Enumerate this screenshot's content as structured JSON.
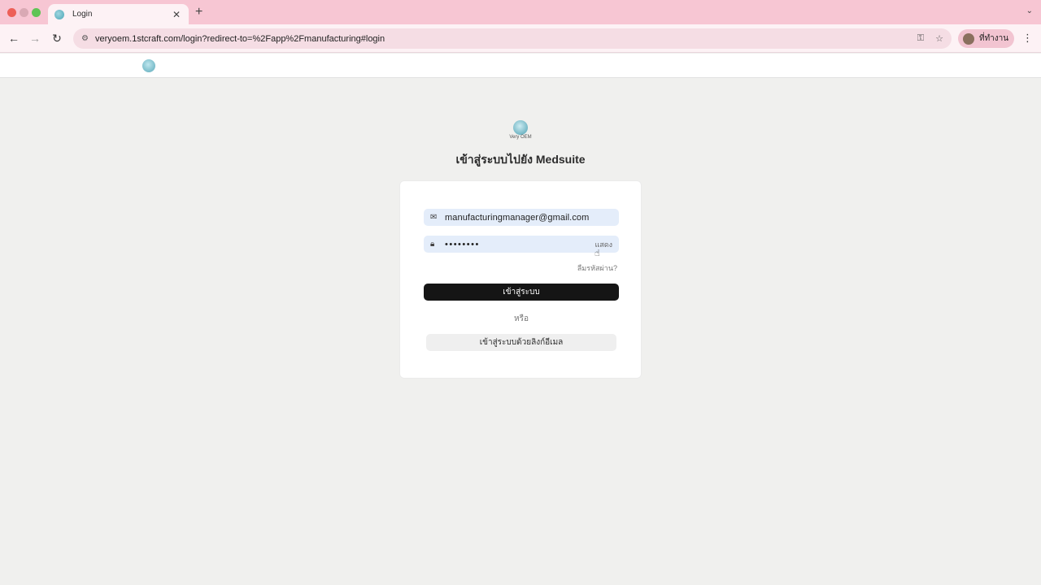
{
  "browser": {
    "tab_title": "Login",
    "new_tab_glyph": "+",
    "close_glyph": "✕",
    "tabs_menu_glyph": "⌄",
    "url": "veryoem.1stcraft.com/login?redirect-to=%2Fapp%2Fmanufacturing#login",
    "profile_label": "ที่ทำงาน",
    "icons": {
      "back": "←",
      "forward": "→",
      "reload": "↻",
      "site_settings": "⚙",
      "password_key": "⚿",
      "bookmark": "☆",
      "menu": "⋮"
    }
  },
  "page": {
    "brand": "Very OEM",
    "title": "เข้าสู่ระบบไปยัง Medsuite"
  },
  "form": {
    "email_value": "manufacturingmanager@gmail.com",
    "email_icon": "✉",
    "password_value": "••••••••",
    "password_icon": "🔒︎",
    "show_label": "แสดง",
    "forgot_label": "ลืมรหัสผ่าน?",
    "submit_label": "เข้าสู่ระบบ",
    "or_label": "หรือ",
    "email_link_label": "เข้าสู่ระบบด้วยลิงก์อีเมล"
  }
}
